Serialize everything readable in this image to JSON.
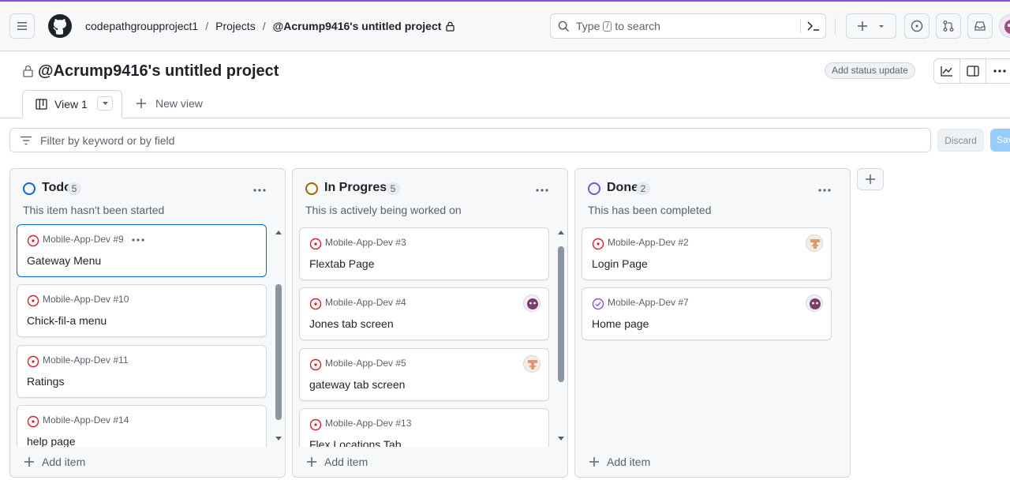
{
  "header": {
    "breadcrumbs": [
      "codepathgroupproject1",
      "Projects",
      "@Acrump9416's untitled project"
    ],
    "search_prefix": "Type",
    "search_key": "/",
    "search_suffix": "to search"
  },
  "project": {
    "title": "@Acrump9416's untitled project",
    "status_update_label": "Add status update",
    "view_tab_label": "View 1",
    "new_view_label": "New view"
  },
  "filter": {
    "placeholder": "Filter by keyword or by field",
    "discard_label": "Discard",
    "save_label": "Save"
  },
  "columns": [
    {
      "name": "Todo",
      "count": "5",
      "description": "This item hasn't been started",
      "color": "#0969da",
      "add_item_label": "Add item",
      "cards": [
        {
          "ref": "Mobile-App-Dev #9",
          "title": "Gateway Menu",
          "state": "open"
        },
        {
          "ref": "Mobile-App-Dev #10",
          "title": "Chick-fil-a menu",
          "state": "open"
        },
        {
          "ref": "Mobile-App-Dev #11",
          "title": "Ratings",
          "state": "open"
        },
        {
          "ref": "Mobile-App-Dev #14",
          "title": "help page",
          "state": "open"
        }
      ]
    },
    {
      "name": "In Progress",
      "count": "5",
      "description": "This is actively being worked on",
      "color": "#9a6700",
      "add_item_label": "Add item",
      "cards": [
        {
          "ref": "Mobile-App-Dev #3",
          "title": "Flextab Page",
          "state": "open"
        },
        {
          "ref": "Mobile-App-Dev #4",
          "title": "Jones tab screen",
          "state": "open",
          "avatar": "purple"
        },
        {
          "ref": "Mobile-App-Dev #5",
          "title": "gateway tab screen",
          "state": "open",
          "avatar": "tan"
        },
        {
          "ref": "Mobile-App-Dev #13",
          "title": "Flex Locations Tab",
          "state": "open"
        }
      ]
    },
    {
      "name": "Done",
      "count": "2",
      "description": "This has been completed",
      "color": "#8250df",
      "add_item_label": "Add item",
      "cards": [
        {
          "ref": "Mobile-App-Dev #2",
          "title": "Login Page",
          "state": "open",
          "avatar": "tan"
        },
        {
          "ref": "Mobile-App-Dev #7",
          "title": "Home page",
          "state": "closed",
          "avatar": "purple"
        }
      ]
    }
  ],
  "colors": {
    "open_issue": "#cf222e",
    "closed_issue": "#8250df",
    "accent": "#0969da"
  }
}
